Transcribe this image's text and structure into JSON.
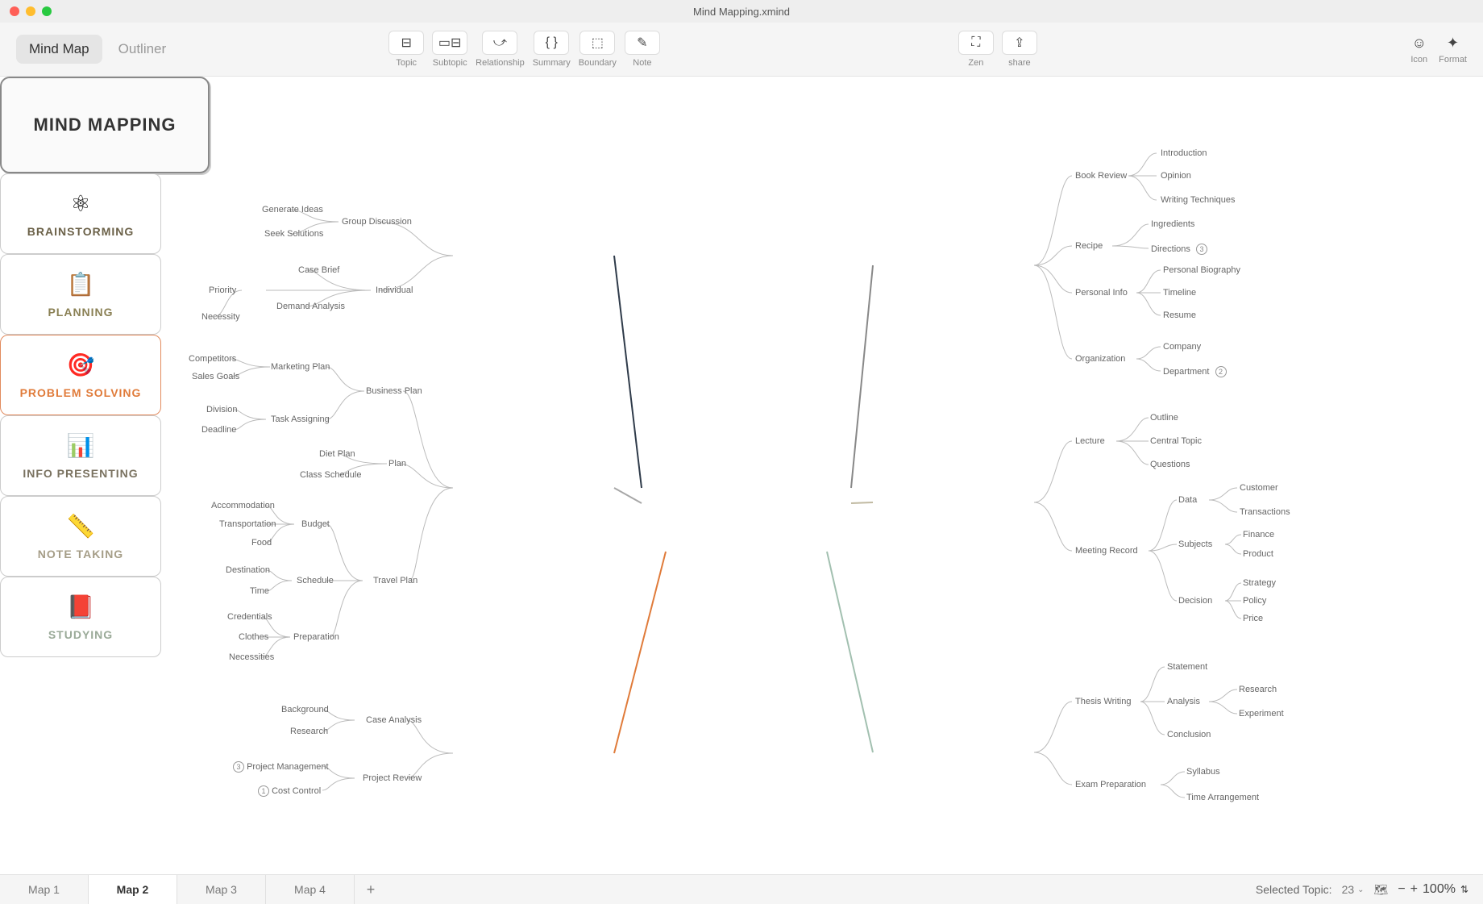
{
  "window": {
    "title": "Mind Mapping.xmind"
  },
  "views": {
    "mindmap": "Mind Map",
    "outliner": "Outliner"
  },
  "tools": {
    "topic": "Topic",
    "subtopic": "Subtopic",
    "relationship": "Relationship",
    "summary": "Summary",
    "boundary": "Boundary",
    "note": "Note",
    "zen": "Zen",
    "share": "share",
    "icon": "Icon",
    "format": "Format"
  },
  "central": "MIND MAPPING",
  "branches": {
    "brainstorming": {
      "label": "BRAINSTORMING",
      "children": [
        {
          "label": "Group Discussion",
          "children": [
            "Generate Ideas",
            "Seek Solutions"
          ]
        },
        {
          "label": "Individual",
          "children": [
            "Case Brief",
            "Priority",
            "Demand Analysis"
          ]
        }
      ],
      "extra_leaf": "Necessity"
    },
    "planning": {
      "label": "PLANNING",
      "children": [
        {
          "label": "Business Plan",
          "children": [
            {
              "label": "Marketing Plan",
              "children": [
                "Competitors",
                "Sales Goals"
              ]
            },
            {
              "label": "Task Assigning",
              "children": [
                "Division",
                "Deadline"
              ]
            }
          ]
        },
        {
          "label": "Plan",
          "children": [
            "Diet Plan",
            "Class Schedule"
          ]
        },
        {
          "label": "Travel Plan",
          "children": [
            {
              "label": "Budget",
              "children": [
                "Accommodation",
                "Transportation",
                "Food"
              ]
            },
            {
              "label": "Schedule",
              "children": [
                "Destination",
                "Time"
              ]
            },
            {
              "label": "Preparation",
              "children": [
                "Credentials",
                "Clothes",
                "Necessities"
              ]
            }
          ]
        }
      ]
    },
    "problem_solving": {
      "label": "PROBLEM SOLVING",
      "children": [
        {
          "label": "Case Analysis",
          "children": [
            "Background",
            "Research"
          ]
        },
        {
          "label": "Project Review",
          "children": [
            {
              "label": "Project Management",
              "badge": "3"
            },
            {
              "label": "Cost Control",
              "badge": "1"
            }
          ]
        }
      ]
    },
    "info_presenting": {
      "label": "INFO PRESENTING",
      "children": [
        {
          "label": "Book Review",
          "children": [
            "Introduction",
            "Opinion",
            "Writing Techniques"
          ]
        },
        {
          "label": "Recipe",
          "children": [
            "Ingredients",
            {
              "label": "Directions",
              "badge": "3"
            }
          ]
        },
        {
          "label": "Personal Info",
          "children": [
            "Personal Biography",
            "Timeline",
            "Resume"
          ]
        },
        {
          "label": "Organization",
          "children": [
            "Company",
            {
              "label": "Department",
              "badge": "2"
            }
          ]
        }
      ]
    },
    "note_taking": {
      "label": "NOTE TAKING",
      "children": [
        {
          "label": "Lecture",
          "children": [
            "Outline",
            "Central Topic",
            "Questions"
          ]
        },
        {
          "label": "Meeting Record",
          "children": [
            {
              "label": "Data",
              "children": [
                "Customer",
                "Transactions"
              ]
            },
            {
              "label": "Subjects",
              "children": [
                "Finance",
                "Product"
              ]
            },
            {
              "label": "Decision",
              "children": [
                "Strategy",
                "Policy",
                "Price"
              ]
            }
          ]
        }
      ]
    },
    "studying": {
      "label": "STUDYING",
      "children": [
        {
          "label": "Thesis Writing",
          "children": [
            "Statement",
            {
              "label": "Analysis",
              "children": [
                "Research",
                "Experiment"
              ]
            },
            "Conclusion"
          ]
        },
        {
          "label": "Exam Preparation",
          "children": [
            "Syllabus",
            "Time Arrangement"
          ]
        }
      ]
    }
  },
  "sheets": [
    "Map 1",
    "Map 2",
    "Map 3",
    "Map 4"
  ],
  "active_sheet": "Map 2",
  "status": {
    "label": "Selected Topic:",
    "count": "23",
    "zoom": "100%"
  }
}
